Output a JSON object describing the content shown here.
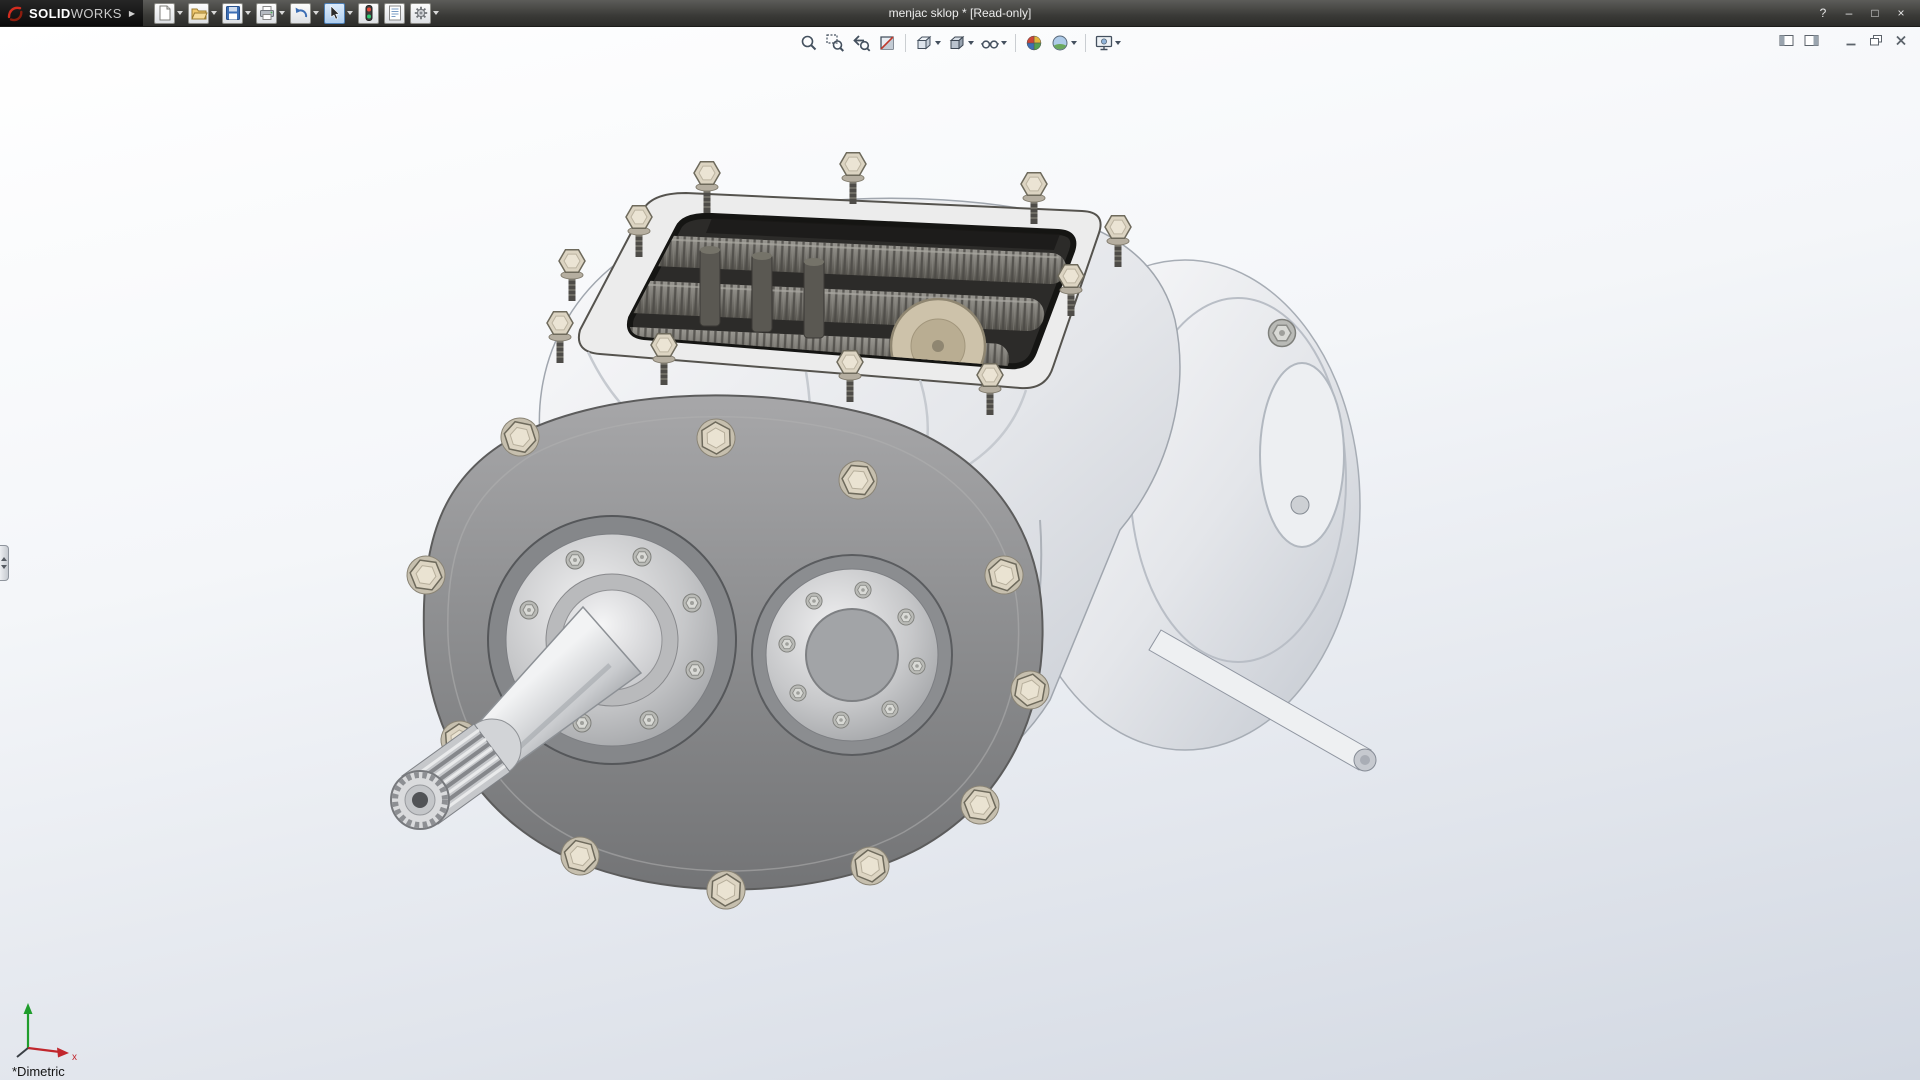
{
  "titlebar": {
    "brand_solid": "SOLID",
    "brand_works": "WORKS",
    "title": "menjac sklop * [Read-only]",
    "help_glyph": "?",
    "minimize_glyph": "–",
    "maximize_glyph": "□",
    "close_glyph": "×",
    "toolbar_items": [
      "new-document",
      "open",
      "save",
      "print",
      "undo",
      "select",
      "rebuild-stoplight",
      "file-properties",
      "options"
    ]
  },
  "heads_up_toolbar": [
    "zoom-to-fit",
    "zoom-to-area",
    "previous-view",
    "section-view",
    "view-orientation",
    "display-style",
    "hide-show-items",
    "edit-appearance",
    "apply-scene",
    "view-settings"
  ],
  "document_window_controls": [
    "feature-pane-toggle",
    "display-pane-toggle",
    "doc-minimize",
    "doc-restore",
    "doc-close"
  ],
  "viewport": {
    "view_label": "*Dimetric",
    "triad_x_label": "x"
  },
  "colors": {
    "titlebar_bg": "#3a3a37",
    "logo_bg": "#0a0a0a",
    "accent_red": "#d22c1f",
    "viewport_top": "#ffffff",
    "viewport_bottom": "#d2d8e2",
    "model_body_light": "#f2f3f5",
    "model_flange": "#8e8f91",
    "bolt_beige": "#dcd4c2",
    "opening_dark": "#2c2b29"
  }
}
